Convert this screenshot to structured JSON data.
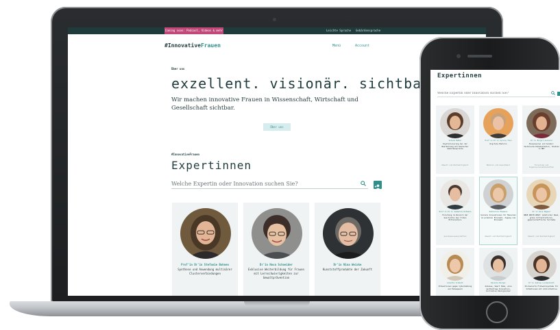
{
  "topbar": {
    "promo": "Coming soon: Podcast, Videos & mehr",
    "links": [
      "Leichte Sprache",
      "Gebärdensprache"
    ]
  },
  "header": {
    "brand_prefix": "#Innovative",
    "brand_suffix": "Frauen",
    "nav": [
      "Menü",
      "Account"
    ]
  },
  "about": {
    "eyebrow": "Über uns",
    "title": "exzellent. visionär. sichtbar",
    "text": "Wir machen innovative Frauen in Wissenschaft, Wirtschaft und Gesellschaft sichtbar.",
    "button": "Über uns"
  },
  "experts": {
    "eyebrow": "#InnovativeFrauen",
    "title": "Expertinnen",
    "search_placeholder": "Welche Expertin oder Innovation suchen Sie?",
    "cards": [
      {
        "name": "Prof'in Dr'in Stefanie Bohnen",
        "desc": "Synthese und Anwendung multinärer Clusterverbindungen"
      },
      {
        "name": "Dr'in Nova Schneider",
        "desc": "Exklusive Weiterbildung für Frauen mit Lernschwierigkeiten zur Gewaltprävention"
      },
      {
        "name": "Dr'in Nina Weiske",
        "desc": "Kunststoffprodukte der Zukunft"
      }
    ]
  },
  "phone": {
    "title": "Expertinnen",
    "search_placeholder": "Welche Expertin oder Innovation suchen Sie?",
    "cards": [
      {
        "name": "Simone Weber",
        "desc": "Digitalisierung bei der Bearbeitung mit Deutscher Gebärdensprache",
        "tag": "Umwelt und Nachhaltigkeit"
      },
      {
        "name": "Prof'in Dr'in Sylvia Thun",
        "desc": "Digitale Medizin",
        "tag": "Medizin und Gesundheit"
      },
      {
        "name": "Dr'in Birgit Gerhard",
        "desc": "Biosensoren und Sonden: Technische Dokumentation, Studien in MRT",
        "tag": "Forschung und Ingenieurwissenschaften"
      },
      {
        "name": "Prof'in Dr'in Isabelle Hofmann",
        "desc": "Forschung im Bereich der Geschichte des frühen Mittelalters",
        "tag": "Geisteswissenschaften"
      },
      {
        "name": "Katharina Emsmann",
        "desc": "Soziale Innovationen für Menschen im prekären Ehrenamt, Zugang zum Ehrenamt",
        "tag": "Umwelt und Nachhaltigkeit"
      },
      {
        "name": "Dr'in Anne Wagner",
        "desc": "NEUE WEITE-WEGE: Ländlicher Raum, grüne Infrastrukturen, gesellschaftliche Teilhabe",
        "tag": "Umwelt und Nachhaltigkeit"
      },
      {
        "name": "Annette Schmidt",
        "desc": "Präventionen gegen Cybermobbing und Hatespeech",
        "tag": ""
      },
      {
        "name": "Daniela Berger",
        "desc": "Zuhause, Smart Home, eine nachhaltige Innovation, Initiative Ökologischer",
        "tag": ""
      },
      {
        "name": "Dr'in Sabine Lindenblatt",
        "desc": "KI-basierte Frühwarnsysteme für Infektionen mit Antiinfektiva",
        "tag": ""
      }
    ]
  }
}
